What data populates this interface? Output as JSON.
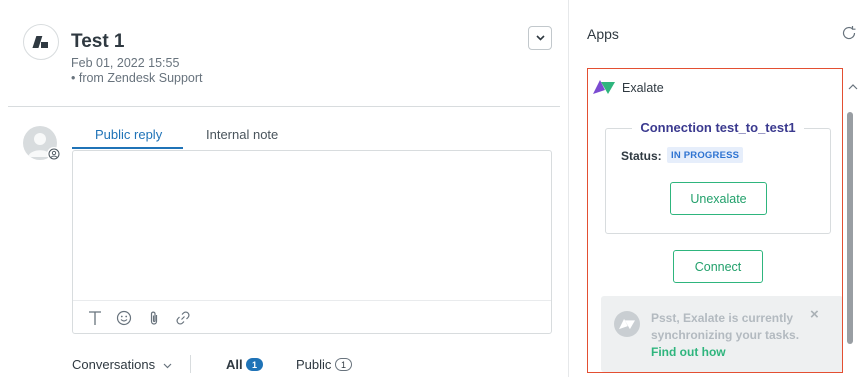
{
  "ticket": {
    "title": "Test 1",
    "date": "Feb 01, 2022 15:55",
    "source": "• from Zendesk Support"
  },
  "composer": {
    "tabs": [
      {
        "label": "Public reply",
        "active": true
      },
      {
        "label": "Internal note",
        "active": false
      }
    ],
    "placeholder": "",
    "toolbar_icons": [
      "text-format-icon",
      "emoji-icon",
      "attachment-icon",
      "link-icon"
    ]
  },
  "conversations": {
    "label": "Conversations",
    "filters": [
      {
        "label": "All",
        "count": "1",
        "active": true
      },
      {
        "label": "Public",
        "count": "1",
        "active": false
      }
    ]
  },
  "apps": {
    "title": "Apps",
    "app_name": "Exalate",
    "connection_title": "Connection test_to_test1",
    "status_label": "Status:",
    "status_value": "IN PROGRESS",
    "unexalate_label": "Unexalate",
    "connect_label": "Connect",
    "banner": {
      "text": "Psst, Exalate is currently synchronizing your tasks.",
      "link": "Find out how",
      "close": "×"
    }
  },
  "colors": {
    "accent_blue": "#1f73b7",
    "exalate_green": "#2eb57d",
    "frame_red": "#e34f32",
    "connection_title": "#3b3a8f"
  }
}
